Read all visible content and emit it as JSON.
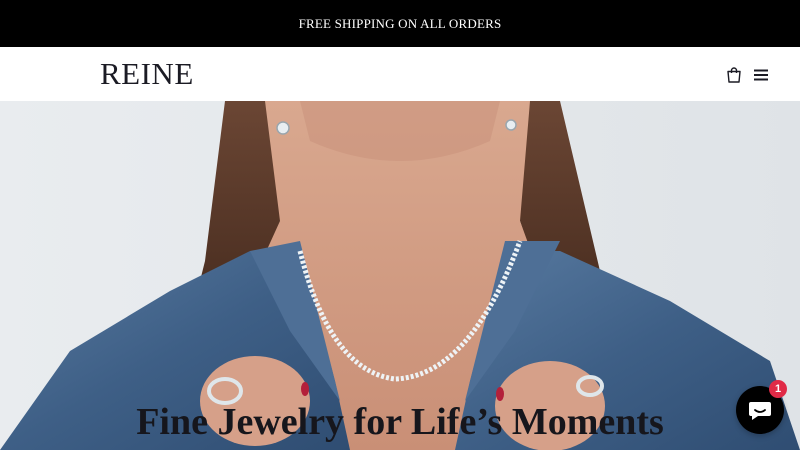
{
  "announcement": {
    "text": "FREE SHIPPING ON ALL ORDERS"
  },
  "header": {
    "logo": "REINE",
    "icons": [
      "cart-icon",
      "menu-icon"
    ]
  },
  "hero": {
    "title": "Fine Jewelry for Life’s Moments"
  },
  "chat": {
    "icon": "chat-icon",
    "badge_count": "1"
  },
  "colors": {
    "announcement_bg": "#000000",
    "announcement_text": "#ffffff",
    "chat_bg": "#000000",
    "badge_bg": "#e02a47"
  }
}
